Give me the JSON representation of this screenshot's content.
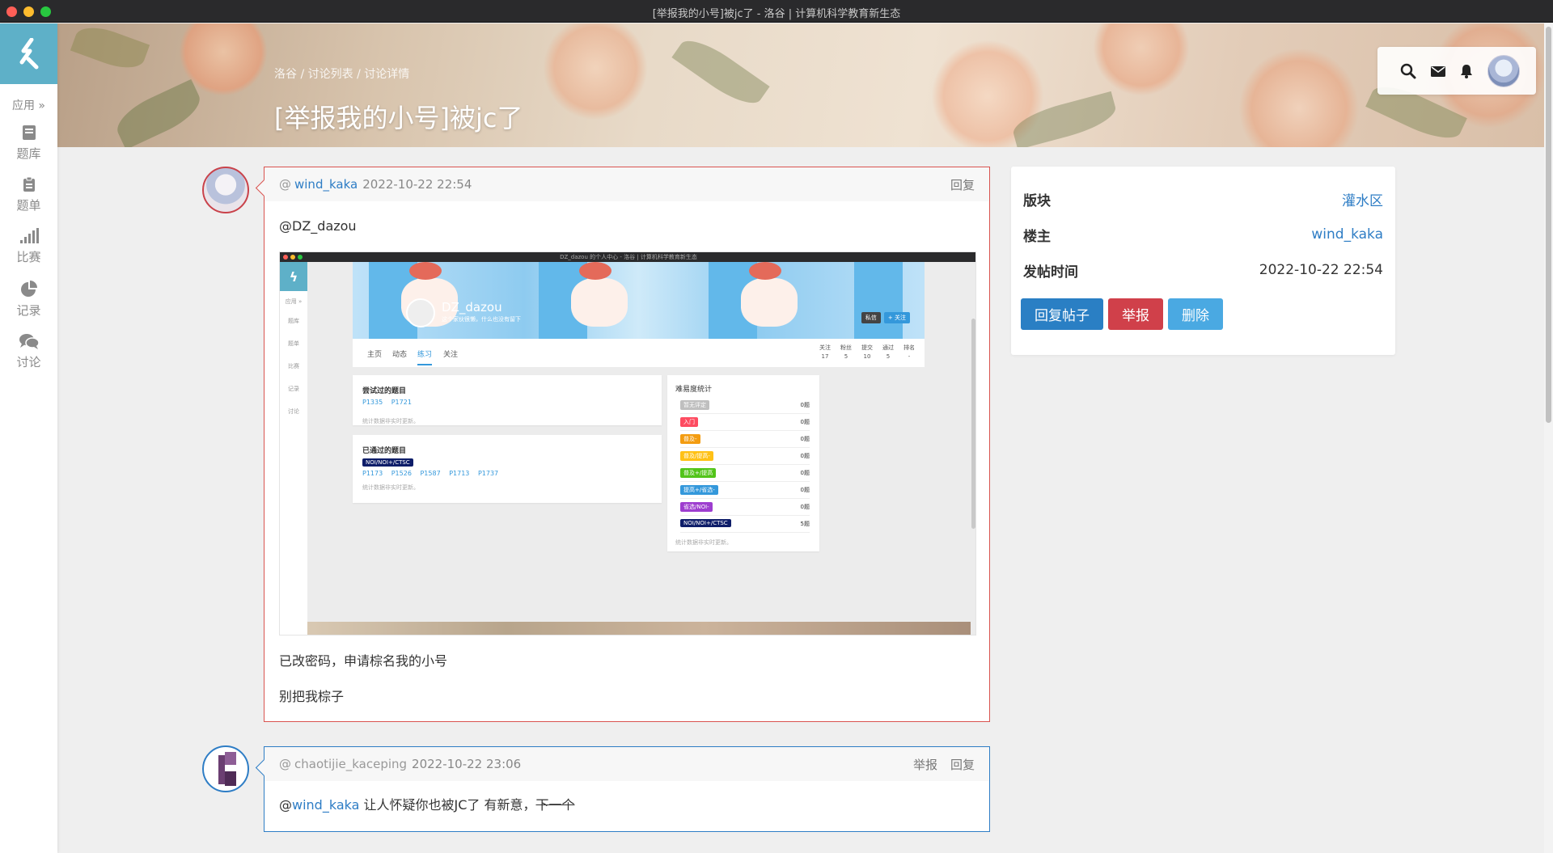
{
  "window": {
    "title": "[举报我的小号]被jc了 - 洛谷 | 计算机科学教育新生态"
  },
  "sidebar": {
    "app_label": "应用 »",
    "items": [
      {
        "label": "题库",
        "icon": "book-icon"
      },
      {
        "label": "题单",
        "icon": "clipboard-icon"
      },
      {
        "label": "比赛",
        "icon": "bar-chart-icon"
      },
      {
        "label": "记录",
        "icon": "pie-chart-icon"
      },
      {
        "label": "讨论",
        "icon": "comments-icon"
      }
    ]
  },
  "header": {
    "breadcrumb": "洛谷 / 讨论列表 / 讨论详情",
    "title": "[举报我的小号]被jc了",
    "tools": [
      "search-icon",
      "mail-icon",
      "bell-icon",
      "avatar"
    ]
  },
  "posts": [
    {
      "at": "@",
      "author": "wind_kaka",
      "time": "2022-10-22 22:54",
      "actions": [
        "回复"
      ],
      "mention": "@DZ_dazou",
      "lines": [
        "已改密码，申请棕名我的小号",
        "别把我棕子"
      ],
      "embedded_screenshot": {
        "title": "DZ_dazou 的个人中心 - 洛谷 | 计算机科学教育新生态",
        "app_label": "应用 »",
        "nav": [
          "题库",
          "题单",
          "比赛",
          "记录",
          "讨论"
        ],
        "username": "DZ_dazou",
        "bio": "这个家伙很懒，什么也没有留下",
        "buttons": [
          "私信",
          "+ 关注"
        ],
        "tabs": [
          "主页",
          "动态",
          "练习",
          "关注"
        ],
        "active_tab": "练习",
        "stats": [
          {
            "label": "关注",
            "value": "17"
          },
          {
            "label": "粉丝",
            "value": "5"
          },
          {
            "label": "提交",
            "value": "10"
          },
          {
            "label": "通过",
            "value": "5"
          },
          {
            "label": "排名",
            "value": "-"
          }
        ],
        "tried": {
          "title": "尝试过的题目",
          "pids": [
            "P1335",
            "P1721"
          ],
          "note": "统计数据非实时更新。"
        },
        "passed": {
          "title": "已通过的题目",
          "tag": "NOI/NOI+/CTSC",
          "pids": [
            "P1173",
            "P1526",
            "P1587",
            "P1713",
            "P1737"
          ],
          "note": "统计数据非实时更新。"
        },
        "difficulty": {
          "title": "难易度统计",
          "rows": [
            {
              "label": "暂无评定",
              "count": "0题",
              "color": "#bfbfbf"
            },
            {
              "label": "入门",
              "count": "0题",
              "color": "#fe4c61"
            },
            {
              "label": "普及-",
              "count": "0题",
              "color": "#f39c11"
            },
            {
              "label": "普及/提高-",
              "count": "0题",
              "color": "#ffc116"
            },
            {
              "label": "普及+/提高",
              "count": "0题",
              "color": "#52c41a"
            },
            {
              "label": "提高+/省选-",
              "count": "0题",
              "color": "#3498db"
            },
            {
              "label": "省选/NOI-",
              "count": "0题",
              "color": "#9d3dcf"
            },
            {
              "label": "NOI/NOI+/CTSC",
              "count": "5题",
              "color": "#0e1d69"
            }
          ],
          "note": "统计数据非实时更新。"
        }
      }
    },
    {
      "at": "@",
      "author": "chaotijie_kaceping",
      "time": "2022-10-22 23:06",
      "actions": [
        "举报",
        "回复"
      ],
      "mention_prefix": "@",
      "mention_user": "wind_kaka",
      "text": " 让人怀疑你也被JC了 有新意，",
      "strike_text": "下一个"
    }
  ],
  "info": {
    "rows": [
      {
        "label": "版块",
        "value": "灌水区"
      },
      {
        "label": "楼主",
        "value": "wind_kaka"
      },
      {
        "label": "发帖时间",
        "value": "2022-10-22 22:54"
      }
    ],
    "buttons": [
      "回复帖子",
      "举报",
      "删除"
    ]
  },
  "colors": {
    "accent": "#2e7dc5",
    "danger": "#d9534f",
    "logo_bg": "#5eb0c8"
  }
}
